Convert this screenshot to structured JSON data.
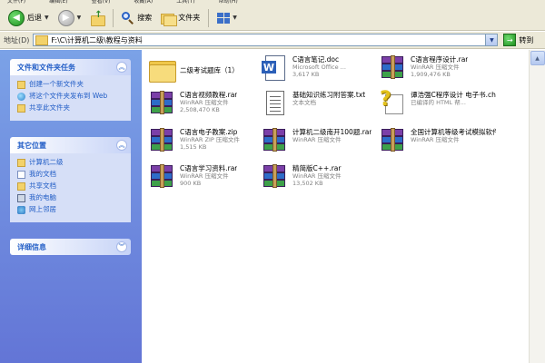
{
  "menubar": {
    "items": [
      "文件(F)",
      "编辑(E)",
      "查看(V)",
      "收藏(A)",
      "工具(T)",
      "帮助(H)"
    ]
  },
  "toolbar": {
    "back_label": "后退",
    "search_label": "搜索",
    "folders_label": "文件夹"
  },
  "address": {
    "label": "地址(D)",
    "path": "F:\\C\\计算机二级\\教程与资料",
    "go_label": "转到"
  },
  "task_panels": {
    "file_tasks": {
      "title": "文件和文件夹任务",
      "items": [
        "创建一个新文件夹",
        "将这个文件夹发布到 Web",
        "共享此文件夹"
      ]
    },
    "other_places": {
      "title": "其它位置",
      "items": [
        "计算机二级",
        "我的文档",
        "共享文档",
        "我的电脑",
        "网上邻居"
      ]
    },
    "details": {
      "title": "详细信息"
    }
  },
  "files": [
    {
      "name": "二级考试题库（1）",
      "type": "",
      "size": "",
      "icon": "folder-icon"
    },
    {
      "name": "C语言笔记.doc",
      "type": "Microsoft Office ...",
      "size": "3,617 KB",
      "icon": "word-doc-icon"
    },
    {
      "name": "C语言程序设计.rar",
      "type": "WinRAR 压缩文件",
      "size": "1,909,476 KB",
      "icon": "winrar-icon"
    },
    {
      "name": "C语言视频教程.rar",
      "type": "WinRAR 压缩文件",
      "size": "2,508,470 KB",
      "icon": "winrar-icon"
    },
    {
      "name": "基础知识练习附答案.txt",
      "type": "文本文档",
      "size": "",
      "icon": "text-doc-icon"
    },
    {
      "name": "谭浩强C程序设计 电子书.chm",
      "type": "已编译的 HTML 帮...",
      "size": "",
      "icon": "chm-help-icon"
    },
    {
      "name": "C语言电子教案.zip",
      "type": "WinRAR ZIP 压缩文件",
      "size": "1,515 KB",
      "icon": "winrar-icon"
    },
    {
      "name": "计算机二级南开100题.rar",
      "type": "WinRAR 压缩文件",
      "size": "",
      "icon": "winrar-icon"
    },
    {
      "name": "全国计算机等级考试模拟软件.rar",
      "type": "WinRAR 压缩文件",
      "size": "",
      "icon": "winrar-icon"
    },
    {
      "name": "C语言学习资料.rar",
      "type": "WinRAR 压缩文件",
      "size": "900 KB",
      "icon": "winrar-icon"
    },
    {
      "name": "精简版C++.rar",
      "type": "WinRAR 压缩文件",
      "size": "13,502 KB",
      "icon": "winrar-icon"
    }
  ]
}
